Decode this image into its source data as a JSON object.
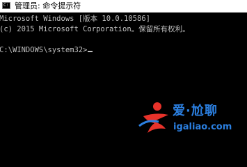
{
  "window": {
    "title": "管理员: 命令提示符",
    "icon": "cmd-icon"
  },
  "console": {
    "lines": [
      "Microsoft Windows [版本 10.0.10586]",
      "(c) 2015 Microsoft Corporation。保留所有权利。",
      "",
      "C:\\WINDOWS\\system32>"
    ]
  },
  "watermark": {
    "title": "爱·尬聊",
    "url": "igaliao.com",
    "accent_color": "#2b7fe0",
    "mark_color": "#e8322a"
  },
  "colors": {
    "background": "#000000",
    "text": "#c0c0c0",
    "titlebar": "#ffffff"
  }
}
